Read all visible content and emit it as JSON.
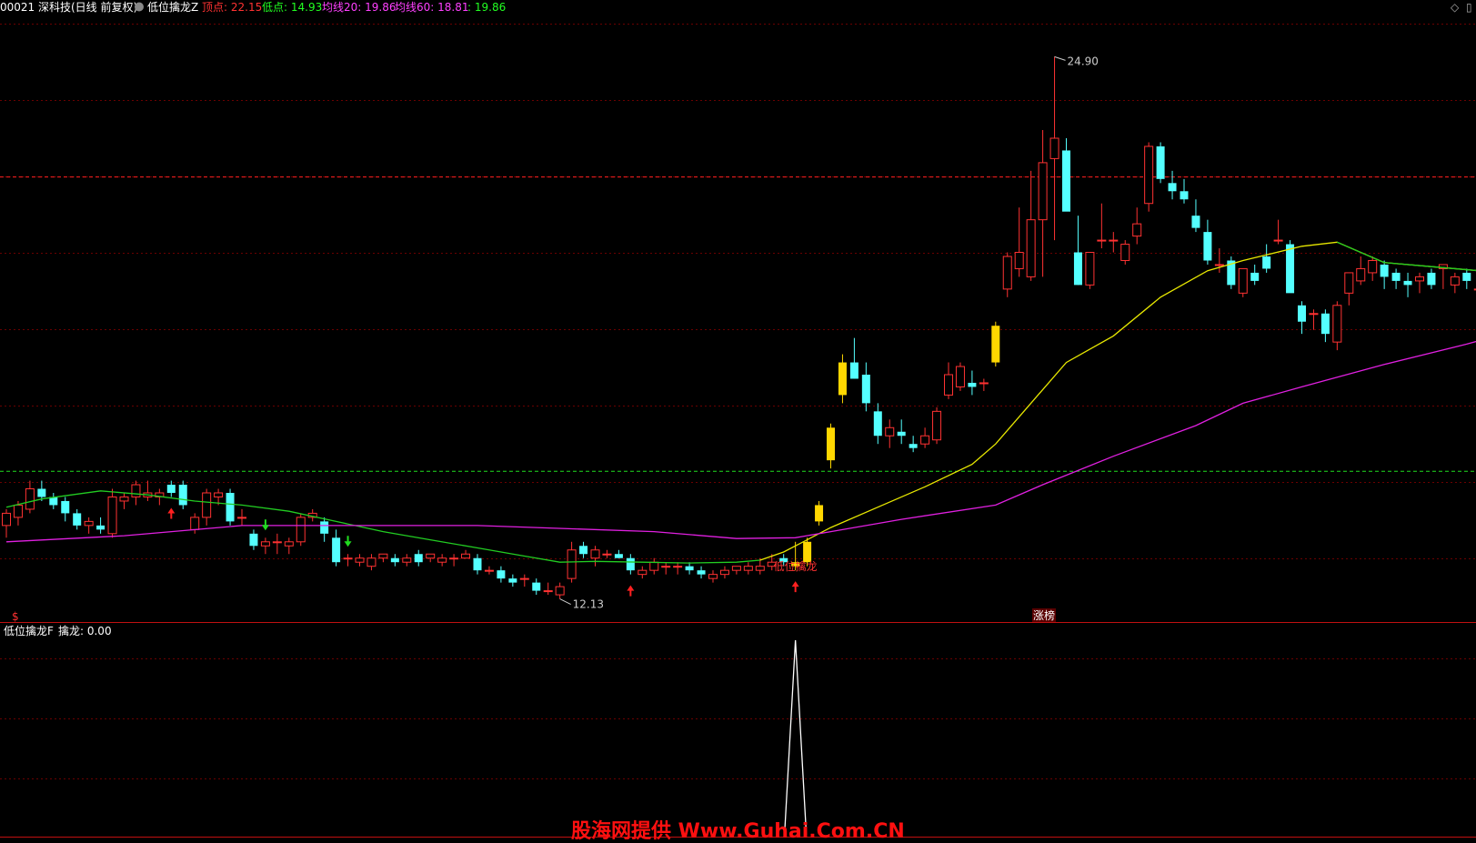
{
  "header": {
    "stock": "00021 深科技(日线 前复权)",
    "indicator": "低位擒龙Z",
    "top_label": "顶点: 22.15",
    "low_label": "低点: 14.93",
    "ma20_label": "均线20: 19.86",
    "ma60_label": "均线60: 18.81",
    "extra_label": ": 19.86"
  },
  "sub_header": {
    "name": "低位擒龙F",
    "value_label": "擒龙: 0.00"
  },
  "annotations": {
    "high": "24.90",
    "low": "12.13",
    "signal": "低位擒龙",
    "limit_up": "涨榜",
    "s_mark": "$"
  },
  "watermark": "股海网提供 Www.Guhai.Com.CN",
  "colors": {
    "up": "#ff3232",
    "down": "#54ffff",
    "ma20_green": "#22cc22",
    "ma20_yellow": "#e8e800",
    "ma60": "#e020e0",
    "signal_bar": "#ffd700",
    "grid": "#6a0000",
    "text_red": "#ff3232",
    "text_green": "#22ff22",
    "text_mag": "#ff40ff",
    "text_yellow": "#ffff40"
  },
  "chart_data": {
    "type": "candlestick",
    "price_range": [
      11.5,
      26.0
    ],
    "top_line": 22.15,
    "low_line": 14.93,
    "candles": [
      [
        13.6,
        14.0,
        13.3,
        13.9
      ],
      [
        13.8,
        14.2,
        13.6,
        14.1
      ],
      [
        14.0,
        14.7,
        13.9,
        14.5
      ],
      [
        14.5,
        14.7,
        14.2,
        14.3
      ],
      [
        14.3,
        14.4,
        14.0,
        14.1
      ],
      [
        14.2,
        14.3,
        13.7,
        13.9
      ],
      [
        13.9,
        14.0,
        13.5,
        13.6
      ],
      [
        13.6,
        13.8,
        13.4,
        13.7
      ],
      [
        13.6,
        13.8,
        13.4,
        13.5
      ],
      [
        13.4,
        14.5,
        13.3,
        14.3
      ],
      [
        14.2,
        14.4,
        14.0,
        14.3
      ],
      [
        14.3,
        14.7,
        14.1,
        14.6
      ],
      [
        14.3,
        14.7,
        14.2,
        14.4
      ],
      [
        14.3,
        14.5,
        14.1,
        14.4
      ],
      [
        14.6,
        14.7,
        14.3,
        14.4
      ],
      [
        14.6,
        14.7,
        14.0,
        14.1
      ],
      [
        13.5,
        13.9,
        13.4,
        13.8
      ],
      [
        13.8,
        14.5,
        13.6,
        14.4
      ],
      [
        14.3,
        14.5,
        14.1,
        14.4
      ],
      [
        14.4,
        14.5,
        13.6,
        13.7
      ],
      [
        13.8,
        14.0,
        13.6,
        13.8
      ],
      [
        13.4,
        13.5,
        13.0,
        13.1
      ],
      [
        13.1,
        13.3,
        12.9,
        13.2
      ],
      [
        13.2,
        13.4,
        12.9,
        13.2
      ],
      [
        13.1,
        13.3,
        12.9,
        13.2
      ],
      [
        13.2,
        13.9,
        13.1,
        13.8
      ],
      [
        13.8,
        14.0,
        13.7,
        13.9
      ],
      [
        13.7,
        13.8,
        13.2,
        13.4
      ],
      [
        13.3,
        13.5,
        12.6,
        12.7
      ],
      [
        12.8,
        12.9,
        12.6,
        12.8
      ],
      [
        12.7,
        12.9,
        12.6,
        12.8
      ],
      [
        12.6,
        12.9,
        12.5,
        12.8
      ],
      [
        12.8,
        12.9,
        12.7,
        12.9
      ],
      [
        12.8,
        12.9,
        12.6,
        12.7
      ],
      [
        12.7,
        12.9,
        12.6,
        12.8
      ],
      [
        12.9,
        13.0,
        12.6,
        12.7
      ],
      [
        12.8,
        12.9,
        12.7,
        12.9
      ],
      [
        12.7,
        12.9,
        12.6,
        12.8
      ],
      [
        12.8,
        12.9,
        12.6,
        12.8
      ],
      [
        12.8,
        13.0,
        12.8,
        12.9
      ],
      [
        12.8,
        12.9,
        12.4,
        12.5
      ],
      [
        12.5,
        12.6,
        12.4,
        12.5
      ],
      [
        12.5,
        12.6,
        12.2,
        12.3
      ],
      [
        12.3,
        12.4,
        12.1,
        12.2
      ],
      [
        12.3,
        12.4,
        12.1,
        12.3
      ],
      [
        12.2,
        12.3,
        11.9,
        12.0
      ],
      [
        12.0,
        12.2,
        11.9,
        12.0
      ],
      [
        11.9,
        12.2,
        11.8,
        12.1
      ],
      [
        12.3,
        13.2,
        12.2,
        13.0
      ],
      [
        13.1,
        13.2,
        12.8,
        12.9
      ],
      [
        12.8,
        13.1,
        12.6,
        13.0
      ],
      [
        12.9,
        13.0,
        12.8,
        12.9
      ],
      [
        12.9,
        13.0,
        12.8,
        12.8
      ],
      [
        12.8,
        12.9,
        12.4,
        12.5
      ],
      [
        12.4,
        12.6,
        12.3,
        12.5
      ],
      [
        12.5,
        12.8,
        12.4,
        12.7
      ],
      [
        12.6,
        12.7,
        12.4,
        12.6
      ],
      [
        12.6,
        12.7,
        12.4,
        12.6
      ],
      [
        12.6,
        12.7,
        12.4,
        12.5
      ],
      [
        12.5,
        12.6,
        12.3,
        12.4
      ],
      [
        12.3,
        12.5,
        12.2,
        12.4
      ],
      [
        12.4,
        12.6,
        12.3,
        12.5
      ],
      [
        12.5,
        12.6,
        12.4,
        12.6
      ],
      [
        12.5,
        12.7,
        12.4,
        12.6
      ],
      [
        12.5,
        12.8,
        12.4,
        12.6
      ],
      [
        12.6,
        12.9,
        12.5,
        12.7
      ],
      [
        12.8,
        12.9,
        12.6,
        12.7
      ],
      [
        12.6,
        13.2,
        12.5,
        12.7
      ],
      [
        12.7,
        13.3,
        12.6,
        13.2
      ],
      [
        13.7,
        14.2,
        13.6,
        14.1
      ],
      [
        15.2,
        16.1,
        15.0,
        16.0
      ],
      [
        16.8,
        17.8,
        16.6,
        17.6
      ],
      [
        17.6,
        18.2,
        17.2,
        17.2
      ],
      [
        17.3,
        17.6,
        16.4,
        16.6
      ],
      [
        16.4,
        16.6,
        15.6,
        15.8
      ],
      [
        15.8,
        16.2,
        15.5,
        16.0
      ],
      [
        15.9,
        16.2,
        15.6,
        15.8
      ],
      [
        15.6,
        15.8,
        15.4,
        15.5
      ],
      [
        15.6,
        16.0,
        15.5,
        15.8
      ],
      [
        15.7,
        16.5,
        15.6,
        16.4
      ],
      [
        16.8,
        17.6,
        16.7,
        17.3
      ],
      [
        17.0,
        17.6,
        16.9,
        17.5
      ],
      [
        17.1,
        17.4,
        16.8,
        17.0
      ],
      [
        17.1,
        17.2,
        16.9,
        17.1
      ],
      [
        17.6,
        18.6,
        17.5,
        18.5
      ],
      [
        19.4,
        20.3,
        19.2,
        20.2
      ],
      [
        19.9,
        21.4,
        19.7,
        20.3
      ],
      [
        19.7,
        22.3,
        19.6,
        21.1
      ],
      [
        21.1,
        23.3,
        19.7,
        22.5
      ],
      [
        22.6,
        25.1,
        20.6,
        23.1
      ],
      [
        22.8,
        23.1,
        21.4,
        21.3
      ],
      [
        20.3,
        21.2,
        19.5,
        19.5
      ],
      [
        19.5,
        20.2,
        19.4,
        20.3
      ],
      [
        20.6,
        21.5,
        20.4,
        20.6
      ],
      [
        20.6,
        20.8,
        20.3,
        20.6
      ],
      [
        20.1,
        20.6,
        20.0,
        20.5
      ],
      [
        20.7,
        21.4,
        20.5,
        21.0
      ],
      [
        21.5,
        23.0,
        21.3,
        22.9
      ],
      [
        22.9,
        23.0,
        22.0,
        22.1
      ],
      [
        22.0,
        22.3,
        21.6,
        21.8
      ],
      [
        21.8,
        22.1,
        21.5,
        21.6
      ],
      [
        21.2,
        21.6,
        20.8,
        20.9
      ],
      [
        20.8,
        21.1,
        20.0,
        20.1
      ],
      [
        20.0,
        20.4,
        19.8,
        20.0
      ],
      [
        20.1,
        20.2,
        19.4,
        19.5
      ],
      [
        19.3,
        19.9,
        19.2,
        19.9
      ],
      [
        19.8,
        20.0,
        19.5,
        19.6
      ],
      [
        20.2,
        20.5,
        19.8,
        19.9
      ],
      [
        20.6,
        21.1,
        20.5,
        20.6
      ],
      [
        20.5,
        20.6,
        19.5,
        19.3
      ],
      [
        19.0,
        19.1,
        18.3,
        18.6
      ],
      [
        18.8,
        18.9,
        18.4,
        18.8
      ],
      [
        18.8,
        18.9,
        18.1,
        18.3
      ],
      [
        18.1,
        19.1,
        17.9,
        19.0
      ],
      [
        19.3,
        19.7,
        19.0,
        19.8
      ],
      [
        19.6,
        20.2,
        19.5,
        19.9
      ],
      [
        19.8,
        20.2,
        19.6,
        20.1
      ],
      [
        20.0,
        20.1,
        19.4,
        19.7
      ],
      [
        19.8,
        19.9,
        19.4,
        19.6
      ],
      [
        19.6,
        19.8,
        19.2,
        19.5
      ],
      [
        19.6,
        19.8,
        19.3,
        19.7
      ],
      [
        19.8,
        19.9,
        19.4,
        19.5
      ],
      [
        19.9,
        20.0,
        19.4,
        20.0
      ],
      [
        19.5,
        19.8,
        19.3,
        19.7
      ],
      [
        19.8,
        19.9,
        19.4,
        19.6
      ],
      [
        19.4,
        19.6,
        19.2,
        19.4
      ],
      [
        19.4,
        19.5,
        18.8,
        18.9
      ],
      [
        18.7,
        18.8,
        18.4,
        18.5
      ],
      [
        18.6,
        19.2,
        18.4,
        18.5
      ],
      [
        18.7,
        19.1,
        18.5,
        19.0
      ]
    ],
    "ma20": [
      [
        0,
        14.05
      ],
      [
        3,
        14.25
      ],
      [
        8,
        14.45
      ],
      [
        12,
        14.35
      ],
      [
        16,
        14.2
      ],
      [
        20,
        14.1
      ],
      [
        24,
        13.95
      ],
      [
        28,
        13.7
      ],
      [
        32,
        13.45
      ],
      [
        36,
        13.25
      ],
      [
        40,
        13.05
      ],
      [
        44,
        12.85
      ],
      [
        47,
        12.7
      ],
      [
        50,
        12.72
      ],
      [
        54,
        12.7
      ],
      [
        58,
        12.68
      ],
      [
        62,
        12.7
      ],
      [
        64,
        12.75
      ],
      [
        66,
        12.95
      ],
      [
        70,
        13.55
      ],
      [
        74,
        14.05
      ],
      [
        78,
        14.55
      ],
      [
        82,
        15.1
      ],
      [
        84,
        15.6
      ],
      [
        87,
        16.6
      ],
      [
        90,
        17.6
      ],
      [
        94,
        18.25
      ],
      [
        98,
        19.2
      ],
      [
        102,
        19.85
      ],
      [
        105,
        20.1
      ],
      [
        110,
        20.45
      ],
      [
        113,
        20.55
      ],
      [
        117,
        20.05
      ],
      [
        121,
        19.95
      ],
      [
        125,
        19.85
      ],
      [
        129,
        19.7
      ],
      [
        131,
        19.6
      ],
      [
        133,
        19.55
      ]
    ],
    "ma20_green_until": 64,
    "ma60": [
      [
        0,
        13.2
      ],
      [
        10,
        13.35
      ],
      [
        20,
        13.6
      ],
      [
        40,
        13.6
      ],
      [
        55,
        13.45
      ],
      [
        62,
        13.28
      ],
      [
        67,
        13.3
      ],
      [
        70,
        13.45
      ],
      [
        76,
        13.75
      ],
      [
        84,
        14.1
      ],
      [
        88,
        14.6
      ],
      [
        94,
        15.3
      ],
      [
        101,
        16.05
      ],
      [
        105,
        16.6
      ],
      [
        110,
        17.0
      ],
      [
        117,
        17.55
      ],
      [
        124,
        18.05
      ],
      [
        129,
        18.45
      ],
      [
        133,
        18.82
      ]
    ],
    "signal_bars": [
      67,
      68,
      69,
      70,
      71,
      84
    ],
    "up_arrows": [
      14,
      53,
      67,
      126
    ],
    "down_arrows": [
      22,
      29
    ],
    "high_index": 89,
    "low_index": 47,
    "sub_peak_index": 67,
    "sub_peak_value": 1.0
  }
}
